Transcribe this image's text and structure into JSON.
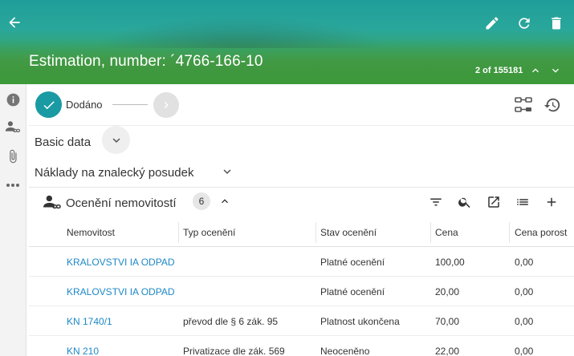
{
  "header": {
    "title": "Estimation, number: ´4766-166-10",
    "pager": "2 of 155181",
    "icons": [
      "arrow-left-icon",
      "pencil-icon",
      "refresh-icon",
      "trash-icon",
      "chevron-up-icon",
      "chevron-down-icon"
    ]
  },
  "rail": {
    "icons": [
      "info-icon",
      "person-link-icon",
      "paperclip-icon",
      "more-icon"
    ]
  },
  "workflow": {
    "step_label": "Dodáno",
    "accent": "#1a9aa3"
  },
  "sections": {
    "basic_data": "Basic data",
    "naklady": "Náklady na znalecký posudek",
    "oceneni": {
      "title": "Ocenění nemovitostí",
      "count": "6"
    }
  },
  "table": {
    "columns": [
      "Nemovitost",
      "Typ ocenění",
      "Stav ocenění",
      "Cena",
      "Cena porost"
    ],
    "rows": [
      {
        "nemovitost": "KRALOVSTVI IA ODPAD ...",
        "typ": "",
        "stav": "Platné ocenění",
        "cena": "100,00",
        "cena_porost": "0,00"
      },
      {
        "nemovitost": "KRALOVSTVI IA ODPAD ...",
        "typ": "",
        "stav": "Platné ocenění",
        "cena": "20,00",
        "cena_porost": "0,00"
      },
      {
        "nemovitost": "KN 1740/1",
        "typ": "převod dle § 6 zák. 95",
        "stav": "Platnost ukončena",
        "cena": "70,00",
        "cena_porost": "0,00"
      },
      {
        "nemovitost": "KN 210",
        "typ": "Privatizace dle zák. 569",
        "stav": "Neoceněno",
        "cena": "22,00",
        "cena_porost": "0,00"
      }
    ]
  },
  "colors": {
    "link": "#1e88c7",
    "header_start": "#1f9e9a",
    "header_end": "#2f8f3d"
  }
}
